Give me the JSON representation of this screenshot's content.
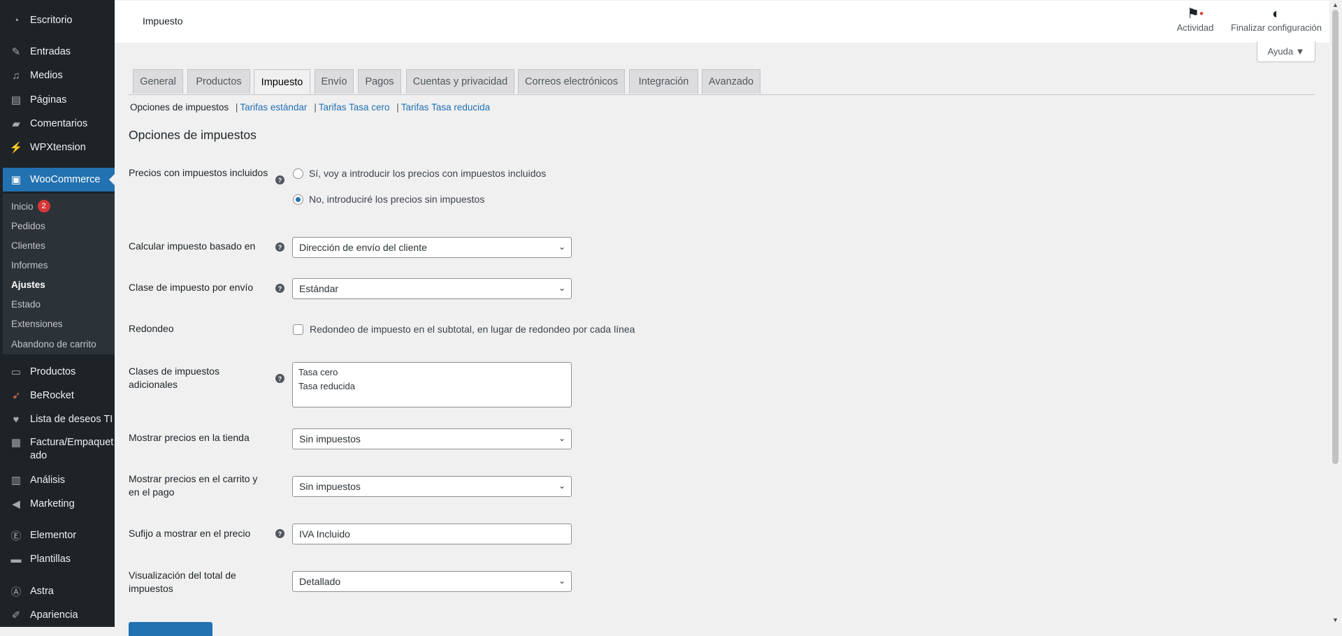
{
  "sidebar": {
    "items_top": [
      {
        "label": "Escritorio",
        "icon": "dashboard-icon"
      },
      {
        "label": "Entradas",
        "icon": "pin-icon"
      },
      {
        "label": "Medios",
        "icon": "media-icon"
      },
      {
        "label": "Páginas",
        "icon": "pages-icon"
      },
      {
        "label": "Comentarios",
        "icon": "comments-icon"
      },
      {
        "label": "WPXtension",
        "icon": "plug-icon"
      },
      {
        "label": "WooCommerce",
        "icon": "woo-icon"
      }
    ],
    "woo_submenu": [
      {
        "label": "Inicio",
        "badge": "2"
      },
      {
        "label": "Pedidos"
      },
      {
        "label": "Clientes"
      },
      {
        "label": "Informes"
      },
      {
        "label": "Ajustes"
      },
      {
        "label": "Estado"
      },
      {
        "label": "Extensiones"
      },
      {
        "label": "Abandono de carrito"
      }
    ],
    "items_bottom": [
      {
        "label": "Productos",
        "icon": "archive-icon"
      },
      {
        "label": "BeRocket",
        "icon": "rocket-icon"
      },
      {
        "label": "Lista de deseos TI",
        "icon": "heart-icon"
      },
      {
        "label": "Factura/Empaquet",
        "label2": "ado",
        "icon": "document-icon"
      },
      {
        "label": "Análisis",
        "icon": "chart-icon"
      },
      {
        "label": "Marketing",
        "icon": "megaphone-icon"
      },
      {
        "label": "Elementor",
        "icon": "elementor-icon"
      },
      {
        "label": "Plantillas",
        "icon": "folder-icon"
      },
      {
        "label": "Astra",
        "icon": "astra-icon"
      },
      {
        "label": "Apariencia",
        "icon": "brush-icon"
      }
    ]
  },
  "header": {
    "title": "Impuesto",
    "activity_label": "Actividad",
    "finish_label": "Finalizar configuración",
    "help_label": "Ayuda ▼"
  },
  "tabs": [
    "General",
    "Productos",
    "Impuesto",
    "Envío",
    "Pagos",
    "Cuentas y privacidad",
    "Correos electrónicos",
    "Integración",
    "Avanzado"
  ],
  "active_tab": "Impuesto",
  "subnav": {
    "current": "Opciones de impuestos",
    "links": [
      "Tarifas estándar",
      "Tarifas Tasa cero",
      "Tarifas Tasa reducida"
    ],
    "separator": "|"
  },
  "form": {
    "section_title": "Opciones de impuestos",
    "prices_incl": {
      "label": "Precios con impuestos incluidos",
      "options": [
        "Sí, voy a introducir los precios con impuestos incluidos",
        "No, introduciré los precios sin impuestos"
      ],
      "selected": 1
    },
    "calc_based": {
      "label": "Calcular impuesto basado en",
      "value": "Dirección de envío del cliente"
    },
    "shipping_class": {
      "label": "Clase de impuesto por envío",
      "value": "Estándar"
    },
    "rounding": {
      "label": "Redondeo",
      "checkbox_label": "Redondeo de impuesto en el subtotal, en lugar de redondeo por cada línea",
      "checked": false
    },
    "additional_classes": {
      "label": "Clases de impuestos adicionales",
      "value": "Tasa cero\nTasa reducida"
    },
    "shop_display": {
      "label": "Mostrar precios en la tienda",
      "value": "Sin impuestos"
    },
    "cart_display": {
      "label": "Mostrar precios en el carrito y en el pago",
      "value": "Sin impuestos"
    },
    "suffix": {
      "label": "Sufijo a mostrar en el precio",
      "value": "IVA Incluido"
    },
    "total_display": {
      "label": "Visualización del total de impuestos",
      "value": "Detallado"
    },
    "help_icon": "?"
  }
}
